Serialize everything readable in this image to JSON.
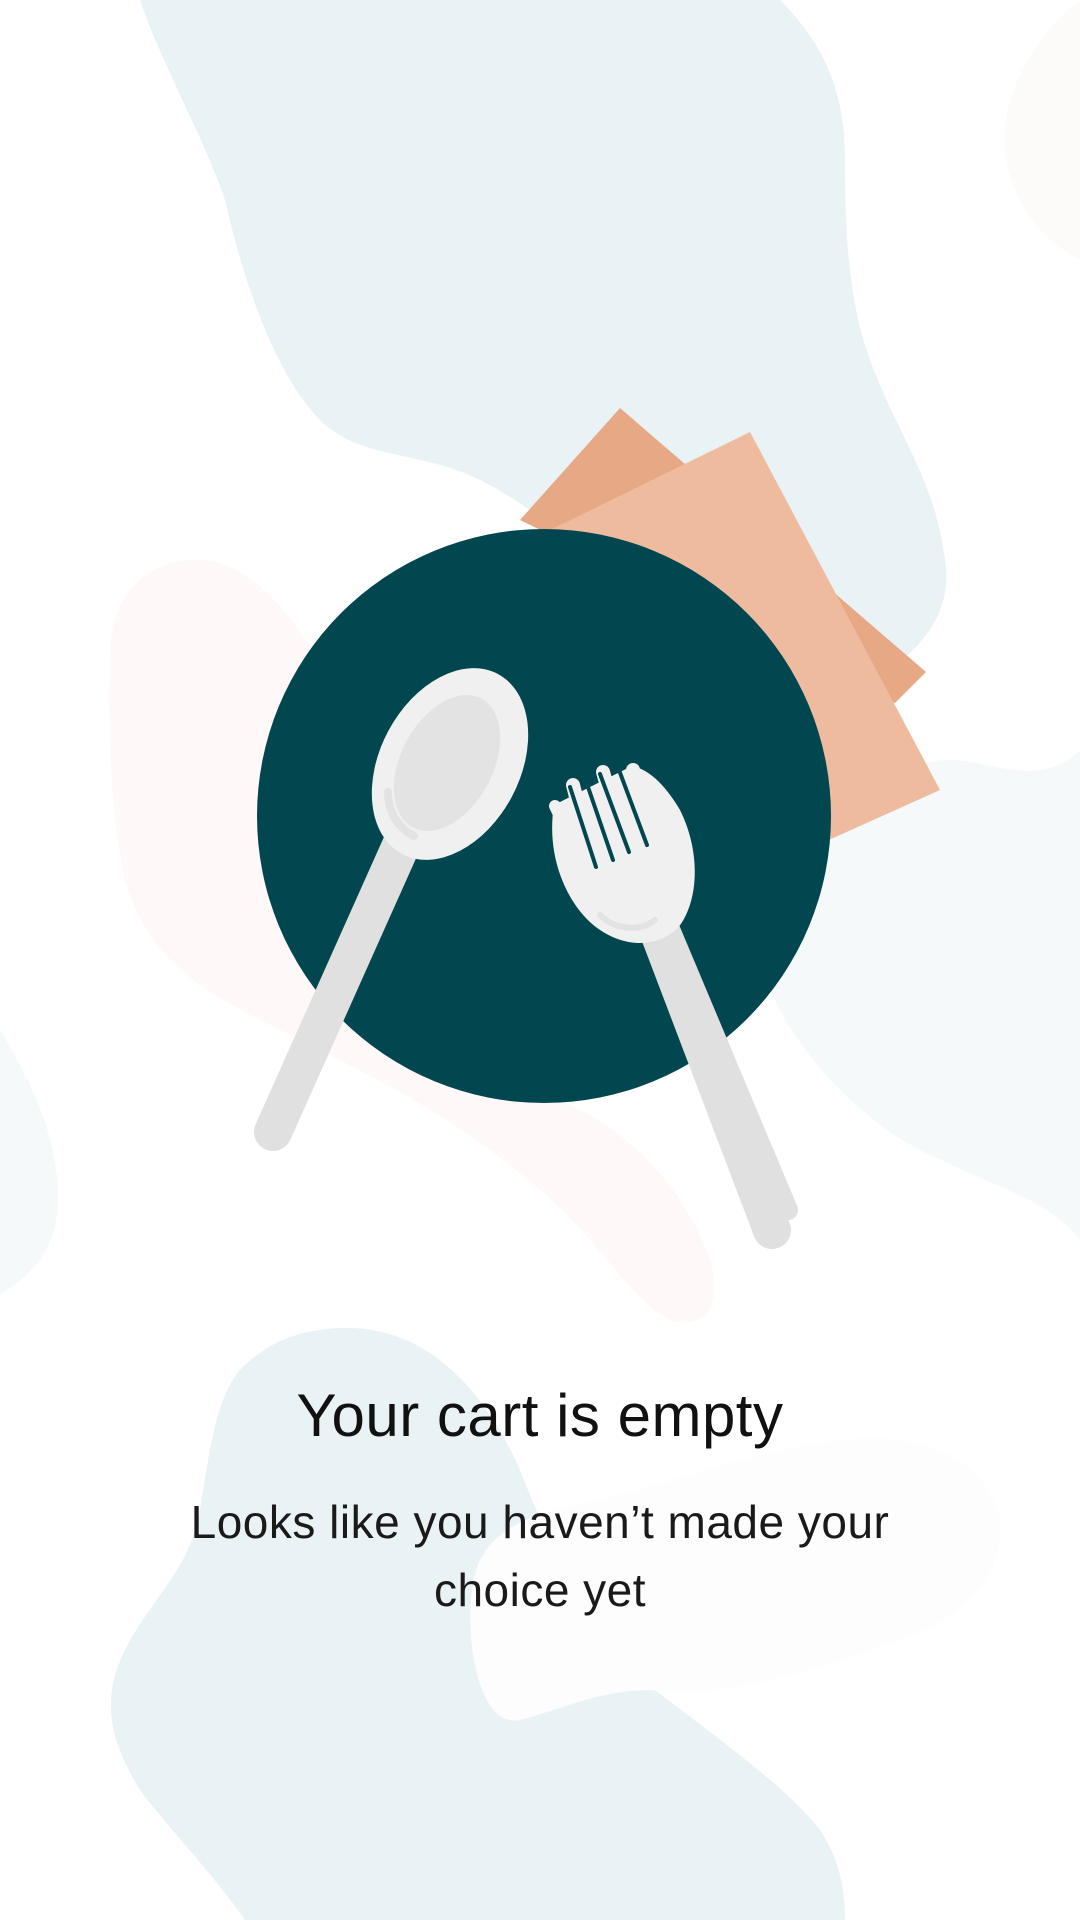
{
  "empty_state": {
    "title": "Your cart is empty",
    "message": "Looks like you haven’t made your choice yet"
  },
  "illustration": {
    "plate_color": "#02474F",
    "napkin_back_color": "#E6A885",
    "napkin_front_color": "#EEBB9F",
    "cutlery_color": "#F0F0F0",
    "cutlery_shade_color": "#E0E0E0"
  },
  "colors": {
    "background": "#FFFFFF",
    "blob_blue": "#E9F2F5",
    "blob_pink": "#FEF8F8",
    "blob_gray": "#F6F9F9",
    "blob_beige": "#FCFBF9",
    "text": "#111111"
  }
}
